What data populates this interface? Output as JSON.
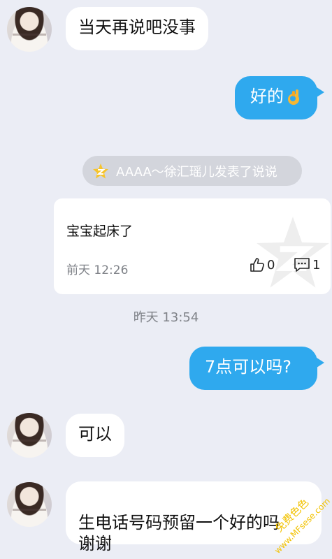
{
  "messages": [
    {
      "side": "in",
      "text": "当天再说吧没事"
    },
    {
      "side": "out",
      "text": "好的"
    },
    {
      "side": "out",
      "text": "7点可以吗?"
    },
    {
      "side": "in",
      "text": "可以"
    },
    {
      "side": "in",
      "text": "生电话号码预留一个好的吗\n谢谢"
    }
  ],
  "qzone_notice": {
    "text": "AAAA～徐汇瑶儿发表了说说",
    "icon": "qzone-star-icon"
  },
  "post_card": {
    "text": "宝宝起床了",
    "time": "前天 12:26",
    "likes": "0",
    "comments": "1"
  },
  "timestamp": "昨天 13:54",
  "watermark": {
    "line1": "免费色色",
    "line2": "www.MFsese.com"
  },
  "colors": {
    "background": "#ebedf5",
    "outgoing_bubble": "#2fa9ee",
    "incoming_bubble": "#ffffff",
    "notice_bg": "#d3d5dc",
    "watermark": "#f2c200"
  }
}
